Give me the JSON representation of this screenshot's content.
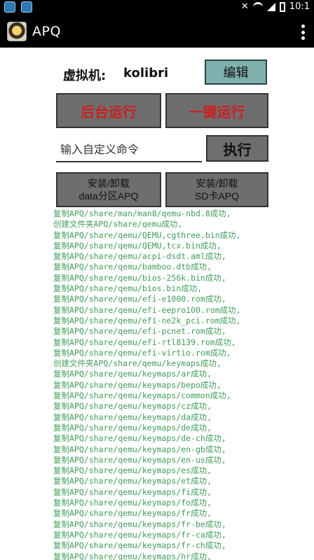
{
  "status_bar": {
    "time": "10:1",
    "icons": [
      "app-icon-1",
      "app-icon-2",
      "mute-icon",
      "wifi-icon",
      "signal-icon",
      "battery-icon"
    ]
  },
  "action_bar": {
    "title": "APQ",
    "overflow_icon": "overflow-menu-icon"
  },
  "vm": {
    "label": "虚拟机:",
    "name": "kolibri"
  },
  "buttons": {
    "edit": "编辑",
    "background_run": "后台运行",
    "one_key_run": "一键运行",
    "execute": "执行",
    "install_data_line1": "安装/卸载",
    "install_data_line2": "data分区APQ",
    "install_sd_line1": "安装/卸载",
    "install_sd_line2": "SD卡APQ"
  },
  "command": {
    "placeholder": "输入自定义命令",
    "value": ""
  },
  "log": [
    "复制APQ/share/man/man8/qemu-nbd.8成功,",
    "创建文件夹APQ/share/qemu成功,",
    "复制APQ/share/qemu/QEMU,cgthree.bin成功,",
    "复制APQ/share/qemu/QEMU,tcx.bin成功,",
    "复制APQ/share/qemu/acpi-dsdt.aml成功,",
    "复制APQ/share/qemu/bamboo.dtb成功,",
    "复制APQ/share/qemu/bios-256k.bin成功,",
    "复制APQ/share/qemu/bios.bin成功,",
    "复制APQ/share/qemu/efi-e1000.rom成功,",
    "复制APQ/share/qemu/efi-eepro100.rom成功,",
    "复制APQ/share/qemu/efi-ne2k_pci.rom成功,",
    "复制APQ/share/qemu/efi-pcnet.rom成功,",
    "复制APQ/share/qemu/efi-rtl8139.rom成功,",
    "复制APQ/share/qemu/efi-virtio.rom成功,",
    "创建文件夹APQ/share/qemu/keymaps成功,",
    "复制APQ/share/qemu/keymaps/ar成功,",
    "复制APQ/share/qemu/keymaps/bepo成功,",
    "复制APQ/share/qemu/keymaps/common成功,",
    "复制APQ/share/qemu/keymaps/cz成功,",
    "复制APQ/share/qemu/keymaps/da成功,",
    "复制APQ/share/qemu/keymaps/de成功,",
    "复制APQ/share/qemu/keymaps/de-ch成功,",
    "复制APQ/share/qemu/keymaps/en-gb成功,",
    "复制APQ/share/qemu/keymaps/en-us成功,",
    "复制APQ/share/qemu/keymaps/es成功,",
    "复制APQ/share/qemu/keymaps/et成功,",
    "复制APQ/share/qemu/keymaps/fi成功,",
    "复制APQ/share/qemu/keymaps/fo成功,",
    "复制APQ/share/qemu/keymaps/fr成功,",
    "复制APQ/share/qemu/keymaps/fr-be成功,",
    "复制APQ/share/qemu/keymaps/fr-ca成功,",
    "复制APQ/share/qemu/keymaps/fr-ch成功,",
    "复制APQ/share/qemu/keymaps/hr成功,"
  ]
}
